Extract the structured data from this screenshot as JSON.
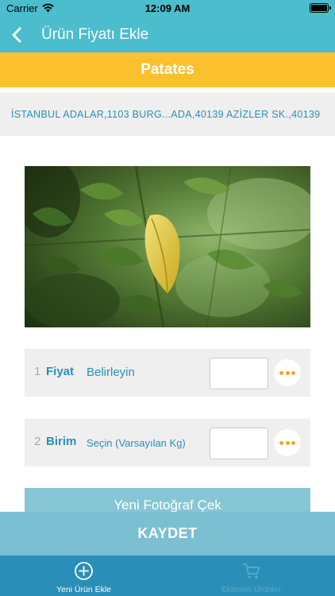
{
  "status_bar": {
    "carrier": "Carrier",
    "time": "12:09 AM"
  },
  "nav": {
    "title": "Ürün Fiyatı Ekle",
    "back_icon": "chevron-left-icon"
  },
  "product": {
    "name": "Patates"
  },
  "address": {
    "text": "İSTANBUL ADALAR,1103 BURG...ADA,40139 AZİZLER SK.,40139"
  },
  "photo": {
    "description_icon": "leaf-photo"
  },
  "form": {
    "rows": [
      {
        "index": "1",
        "label": "Fiyat",
        "value": "Belirleyin",
        "input_value": ""
      },
      {
        "index": "2",
        "label": "Birim",
        "value": "Seçin (Varsayılan Kg)",
        "input_value": ""
      }
    ],
    "more_icon": "ellipsis-icon"
  },
  "photo_button": {
    "label": "Yeni Fotoğraf Çek"
  },
  "save_button": {
    "label": "KAYDET"
  },
  "tabs": [
    {
      "label": "Yeni Ürün Ekle",
      "icon": "plus-circle-icon",
      "active": true
    },
    {
      "label": "Eklenen Ürünler",
      "icon": "cart-icon",
      "active": false
    }
  ],
  "colors": {
    "primary": "#4bbdcc",
    "product_bar": "#fbc02d",
    "accent_text": "#2a8fb8",
    "more_dots": "#f5a623",
    "tab_bar": "#2a8fb8"
  }
}
